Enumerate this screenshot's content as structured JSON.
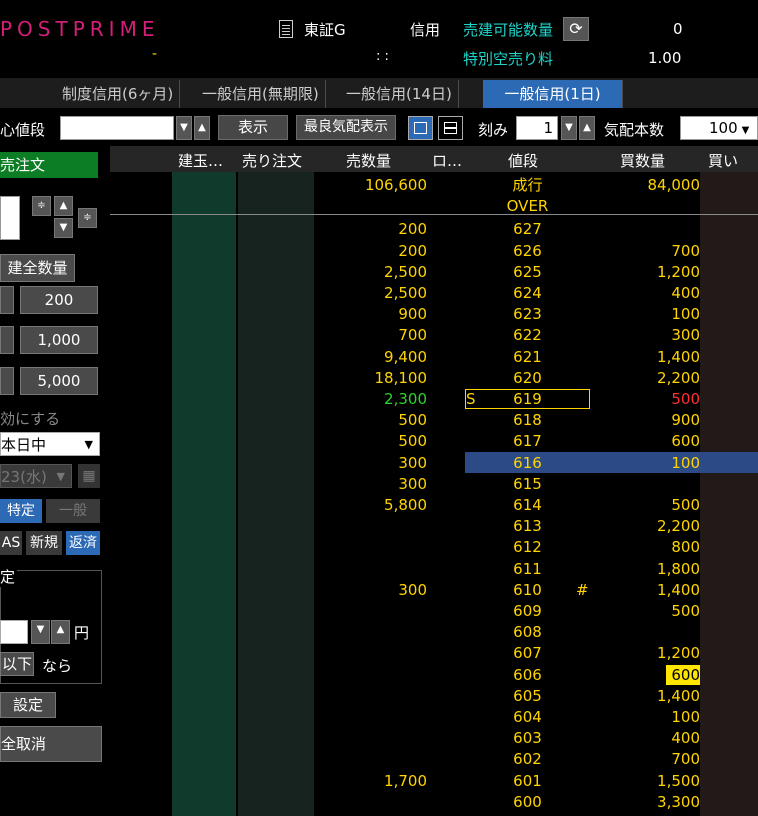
{
  "header": {
    "brand": "POSTPRIME",
    "brand_sub": "-",
    "exchange": "東証G",
    "time": ": :",
    "credit": "信用",
    "short_sellable_label": "売建可能数量",
    "short_sellable_qty": "0",
    "special_fee_label": "特別空売り料",
    "special_fee_value": "1.00"
  },
  "tabs": [
    {
      "label": "制度信用(6ヶ月)",
      "active": false
    },
    {
      "label": "一般信用(無期限)",
      "active": false
    },
    {
      "label": "一般信用(14日)",
      "active": false
    },
    {
      "label": "一般信用(1日)",
      "active": true
    }
  ],
  "toolbar": {
    "center_price_label": "心値段",
    "center_price_value": "",
    "show_button": "表示",
    "best_quote_button": "最良気配表示",
    "tick_label": "刻み",
    "tick_value": "1",
    "quote_count_label": "気配本数",
    "quote_count_value": "100"
  },
  "left_panel": {
    "sell_order": "売注文",
    "close_all_qty": "建全数量",
    "qty_buttons": [
      "200",
      "1,000",
      "5,000"
    ],
    "enable_label": "効にする",
    "period_select": "本日中",
    "date_select": "23(水)",
    "account_specific": "特定",
    "account_general": "一般",
    "sas_label": "AS",
    "new_label": "新規",
    "repay_label": "返済",
    "cond_title": "定",
    "cond_sub": "",
    "yen_label": "円",
    "below_button": "以下",
    "then_label": "なら",
    "set_button": "設定",
    "cancel_all_button": "全取消"
  },
  "grid": {
    "headers": {
      "position": "建玉…",
      "sell_order": "売り注文",
      "sell_qty": "売数量",
      "other": "ロ…",
      "price": "値段",
      "buy_qty": "買数量",
      "buy_order": "買い"
    },
    "market_row": {
      "sell_qty": "106,600",
      "price": "成行",
      "buy_qty": "84,000"
    },
    "over_label": "OVER",
    "rows": [
      {
        "price": "627",
        "sell": "200",
        "buy": ""
      },
      {
        "price": "626",
        "sell": "200",
        "buy": "700"
      },
      {
        "price": "625",
        "sell": "2,500",
        "buy": "1,200"
      },
      {
        "price": "624",
        "sell": "2,500",
        "buy": "400"
      },
      {
        "price": "623",
        "sell": "900",
        "buy": "100"
      },
      {
        "price": "622",
        "sell": "700",
        "buy": "300"
      },
      {
        "price": "621",
        "sell": "9,400",
        "buy": "1,400"
      },
      {
        "price": "620",
        "sell": "18,100",
        "buy": "2,200"
      },
      {
        "price": "619",
        "sell": "2,300",
        "buy": "500",
        "mark": "S"
      },
      {
        "price": "618",
        "sell": "500",
        "buy": "900"
      },
      {
        "price": "617",
        "sell": "500",
        "buy": "600"
      },
      {
        "price": "616",
        "sell": "300",
        "buy": "100"
      },
      {
        "price": "615",
        "sell": "300",
        "buy": ""
      },
      {
        "price": "614",
        "sell": "5,800",
        "buy": "500"
      },
      {
        "price": "613",
        "sell": "",
        "buy": "2,200"
      },
      {
        "price": "612",
        "sell": "",
        "buy": "800"
      },
      {
        "price": "611",
        "sell": "",
        "buy": "1,800"
      },
      {
        "price": "610",
        "sell": "300",
        "buy": "1,400",
        "mark": "#"
      },
      {
        "price": "609",
        "sell": "",
        "buy": "500"
      },
      {
        "price": "608",
        "sell": "",
        "buy": ""
      },
      {
        "price": "607",
        "sell": "",
        "buy": "1,200"
      },
      {
        "price": "606",
        "sell": "",
        "buy": "600"
      },
      {
        "price": "605",
        "sell": "",
        "buy": "1,400"
      },
      {
        "price": "604",
        "sell": "",
        "buy": "100"
      },
      {
        "price": "603",
        "sell": "",
        "buy": "400"
      },
      {
        "price": "602",
        "sell": "",
        "buy": "700"
      },
      {
        "price": "601",
        "sell": "1,700",
        "buy": "1,500"
      },
      {
        "price": "600",
        "sell": "",
        "buy": "3,300"
      }
    ]
  },
  "colors": {
    "brand": "#d31f78",
    "accent_blue": "#2c6ab5",
    "quote_yellow": "#ffd400",
    "label_cyan": "#1dd5c9",
    "sell_green": "#0d7d25",
    "last_trade_green": "#2dd32d",
    "up_red": "#ff3030"
  }
}
